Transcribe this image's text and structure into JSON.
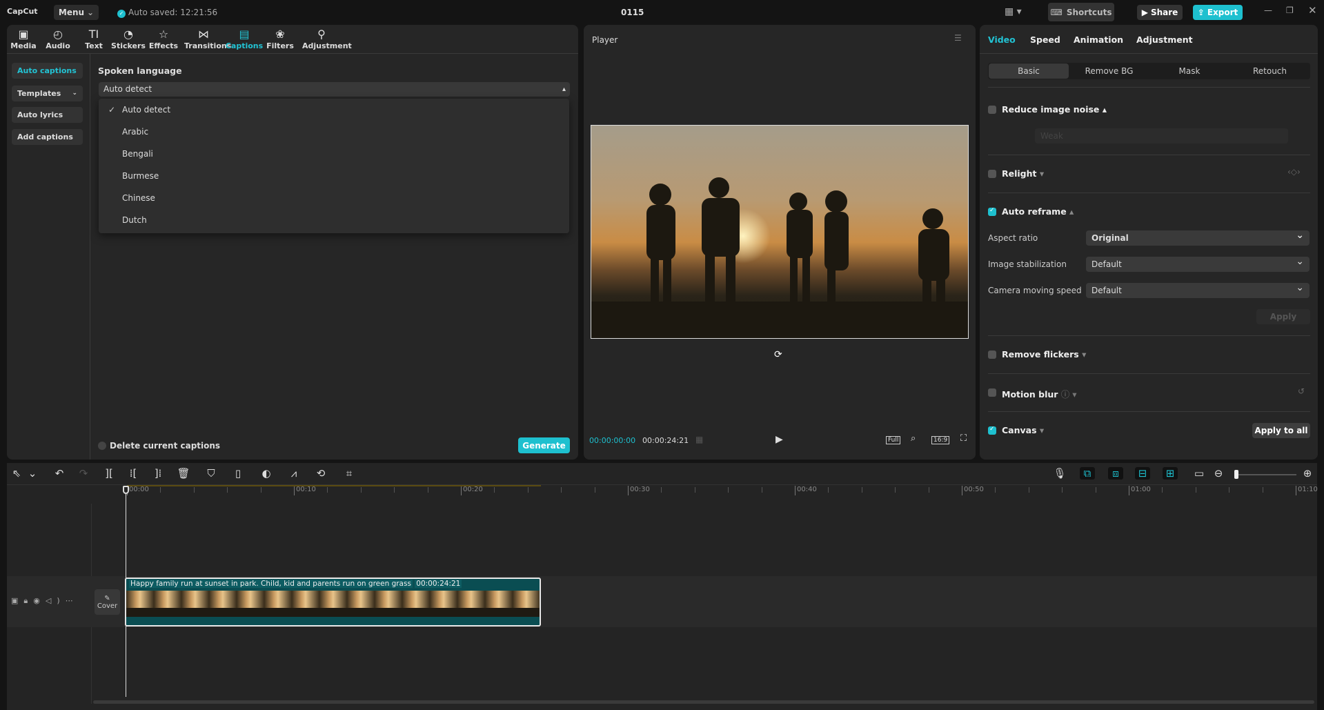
{
  "topbar": {
    "logo": "CapCut",
    "menu": "Menu",
    "autosave": "Auto saved: 12:21:56",
    "title": "0115",
    "shortcuts": "Shortcuts",
    "share": "Share",
    "export": "Export"
  },
  "tools": [
    {
      "label": "Media",
      "icon": "▣"
    },
    {
      "label": "Audio",
      "icon": "◴"
    },
    {
      "label": "Text",
      "icon": "TI"
    },
    {
      "label": "Stickers",
      "icon": "◔"
    },
    {
      "label": "Effects",
      "icon": "☆"
    },
    {
      "label": "Transitions",
      "icon": "⋈"
    },
    {
      "label": "Captions",
      "icon": "▤"
    },
    {
      "label": "Filters",
      "icon": "❀"
    },
    {
      "label": "Adjustment",
      "icon": "⚲"
    }
  ],
  "captions_sidebar": [
    "Auto captions",
    "Templates",
    "Auto lyrics",
    "Add captions"
  ],
  "captions": {
    "spoken_language_label": "Spoken language",
    "selected": "Auto detect",
    "options": [
      "Auto detect",
      "Arabic",
      "Bengali",
      "Burmese",
      "Chinese",
      "Dutch"
    ],
    "delete_label": "Delete current captions",
    "generate": "Generate"
  },
  "player": {
    "title": "Player",
    "current_time": "00:00:00:00",
    "duration": "00:00:24:21",
    "full": "Full",
    "ratio": "16:9"
  },
  "inspector": {
    "tabs": [
      "Video",
      "Speed",
      "Animation",
      "Adjustment"
    ],
    "subtabs": [
      "Basic",
      "Remove BG",
      "Mask",
      "Retouch"
    ],
    "reduce_noise": "Reduce image noise",
    "noise_level": "Weak",
    "relight": "Relight",
    "auto_reframe": "Auto reframe",
    "aspect_ratio_label": "Aspect ratio",
    "aspect_ratio": "Original",
    "stabilization_label": "Image stabilization",
    "stabilization": "Default",
    "camera_speed_label": "Camera moving speed",
    "camera_speed": "Default",
    "apply": "Apply",
    "remove_flickers": "Remove flickers",
    "motion_blur": "Motion blur",
    "canvas": "Canvas",
    "apply_all": "Apply to all"
  },
  "timeline": {
    "ruler": [
      "00:00",
      "00:10",
      "00:20",
      "00:30",
      "00:40",
      "00:50",
      "01:00",
      "01:10"
    ],
    "clip_title": "Happy family run at sunset in park. Child, kid and parents run on green grass",
    "clip_duration": "00:00:24:21",
    "cover": "Cover"
  },
  "colors": {
    "accent": "#1ec0cf",
    "clip": "#0a4d52"
  }
}
